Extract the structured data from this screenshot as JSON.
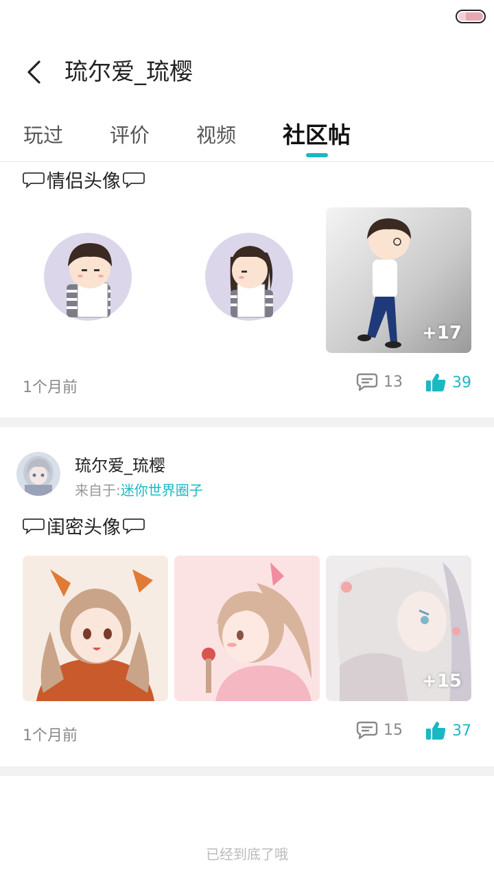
{
  "header": {
    "title": "琉尔爱_琉樱",
    "back_icon": "chevron-left-icon"
  },
  "tabs": [
    {
      "label": "玩过",
      "active": false
    },
    {
      "label": "评价",
      "active": false
    },
    {
      "label": "视频",
      "active": false
    },
    {
      "label": "社区帖",
      "active": true
    }
  ],
  "posts": [
    {
      "title": "情侣头像",
      "image_more": "+17",
      "time": "1个月前",
      "comments": "13",
      "likes": "39"
    },
    {
      "author": "琉尔爱_琉樱",
      "from_label": "来自于:",
      "from_circle": "迷你世界圈子",
      "title": "闺密头像",
      "image_more": "+15",
      "time": "1个月前",
      "comments": "15",
      "likes": "37"
    }
  ],
  "footer": {
    "end_text": "已经到底了哦"
  },
  "colors": {
    "accent": "#1bb7c3",
    "muted": "#888888"
  }
}
